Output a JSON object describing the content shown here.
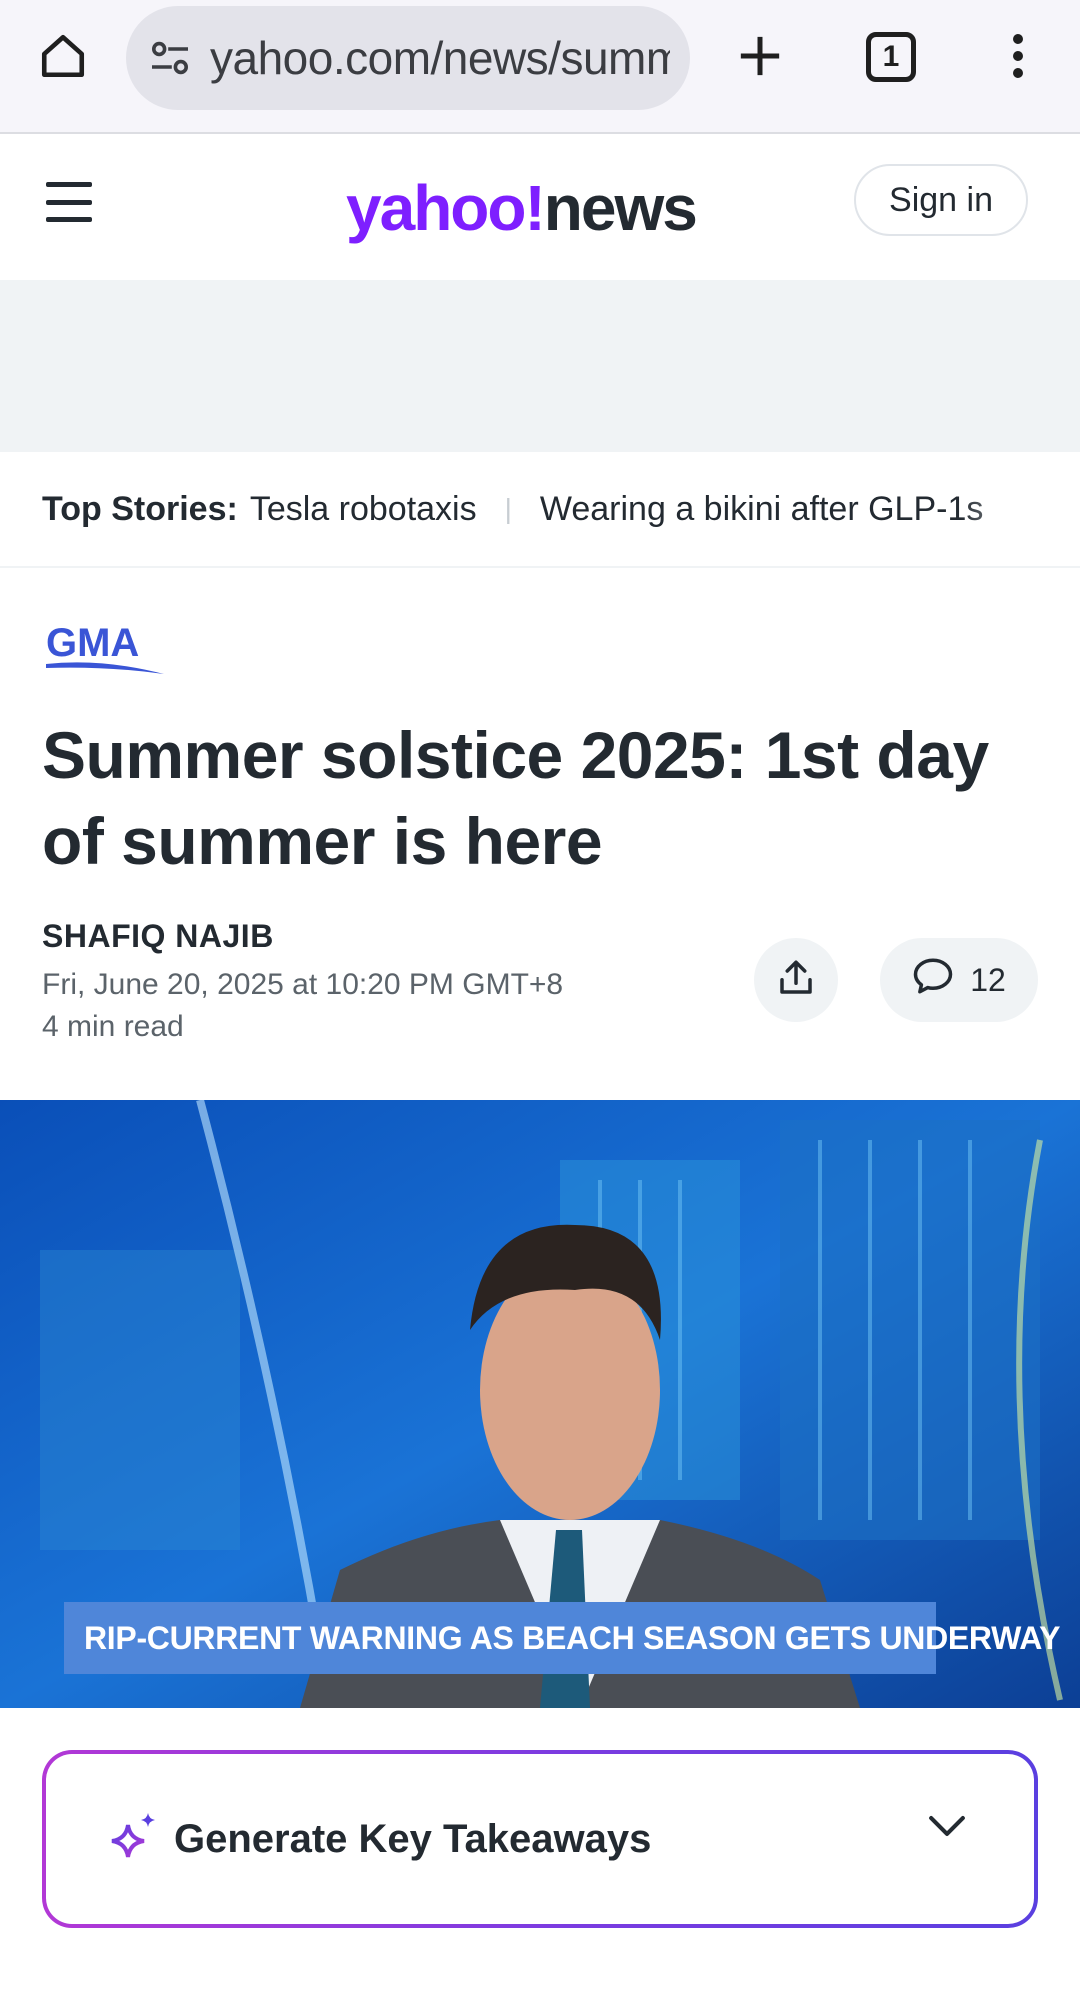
{
  "browser": {
    "url": "yahoo.com/news/summ",
    "tab_count": "1",
    "icons": [
      "home-icon",
      "site-settings-icon",
      "new-tab-plus-icon",
      "tab-switcher-icon",
      "more-vert-icon"
    ]
  },
  "header": {
    "logo_yahoo": "yahoo!",
    "logo_news": "news",
    "sign_in": "Sign in",
    "brand_color": "#7e1fff"
  },
  "top_stories": {
    "label": "Top Stories:",
    "items": [
      "Tesla robotaxis",
      "Wearing a bikini after GLP-1s"
    ]
  },
  "article": {
    "source_logo": "GMA",
    "headline": "Summer solstice 2025: 1st day of summer is here",
    "author": "SHAFIQ NAJIB",
    "date": "Fri, June 20, 2025 at 10:20 PM GMT+8",
    "read_time": "4 min read",
    "comment_count": "12"
  },
  "video": {
    "lower_third": "RIP-CURRENT WARNING AS BEACH SEASON GETS UNDERWAY"
  },
  "takeaways": {
    "label": "Generate Key Takeaways",
    "gradient_colors": [
      "#b238d6",
      "#7d3be0",
      "#5a3fe0"
    ]
  }
}
